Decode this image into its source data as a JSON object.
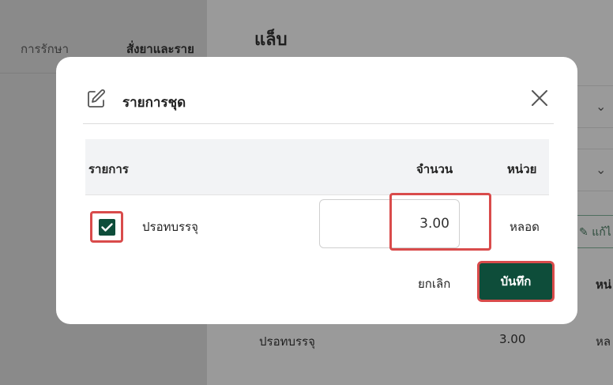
{
  "background": {
    "tabs": [
      "การรักษา",
      "สั่งยาและราย"
    ],
    "section_title": "แล็บ",
    "edit_label": "แก้ไ",
    "column_header": "หน่",
    "row": {
      "name": "ปรอทบรรจุ",
      "qty": "3.00",
      "unit": "หล"
    }
  },
  "modal": {
    "title": "รายการชุด",
    "columns": {
      "item": "รายการ",
      "qty": "จำนวน",
      "unit": "หน่วย"
    },
    "row": {
      "name": "ปรอทบรรจุ",
      "qty": "3.00",
      "unit": "หลอด",
      "checked": true
    },
    "cancel_label": "ยกเลิก",
    "save_label": "บันทึก"
  },
  "colors": {
    "primary": "#0e4d3a",
    "highlight": "#d94b4b"
  }
}
